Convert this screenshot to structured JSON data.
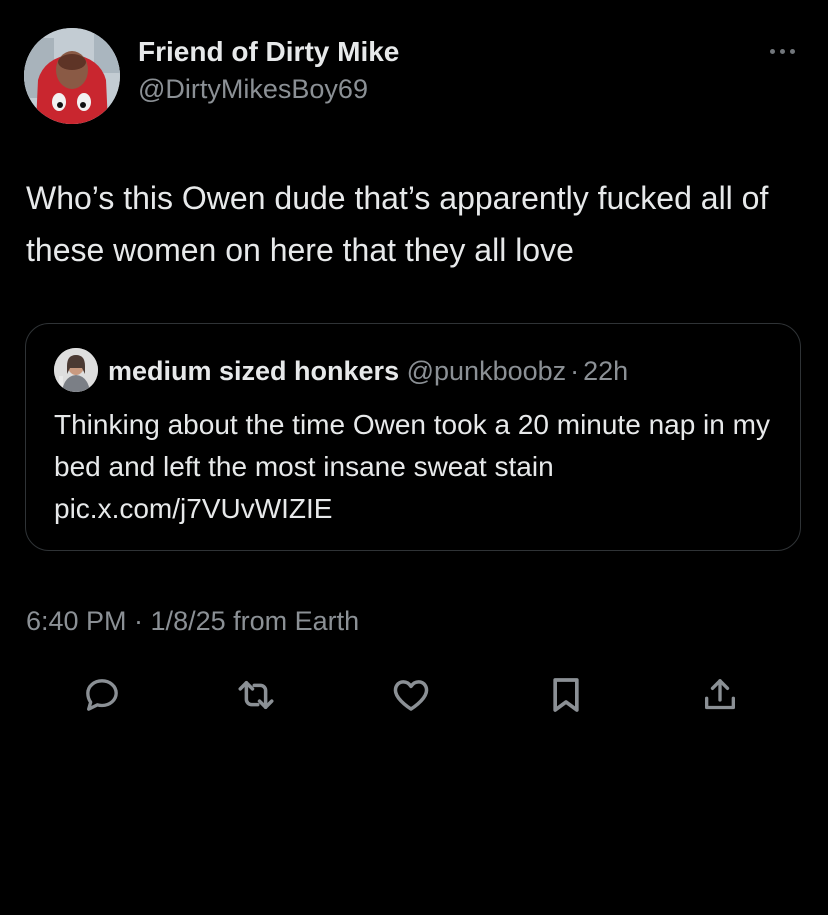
{
  "author": {
    "display_name": "Friend of Dirty Mike",
    "handle": "@DirtyMikesBoy69"
  },
  "tweet": {
    "text": "Who’s this Owen dude that’s apparently fucked all of these women on here that they all love"
  },
  "quoted": {
    "display_name": "medium sized honkers",
    "handle": "@punkboobz",
    "separator": "·",
    "time": "22h",
    "text": "Thinking about the time Owen took a 20 minute nap in my bed and left the most insane sweat stain pic.x.com/j7VUvWIZIE"
  },
  "meta": {
    "timestamp": "6:40 PM · 1/8/25 from Earth"
  },
  "actions": {
    "icons": [
      "reply-icon",
      "retweet-icon",
      "like-icon",
      "bookmark-icon",
      "share-icon"
    ]
  },
  "colors": {
    "background": "#000000",
    "primary_text": "#e7e9ea",
    "secondary_text": "#8b9095",
    "border": "#2f3336",
    "icon": "#8b9095"
  }
}
